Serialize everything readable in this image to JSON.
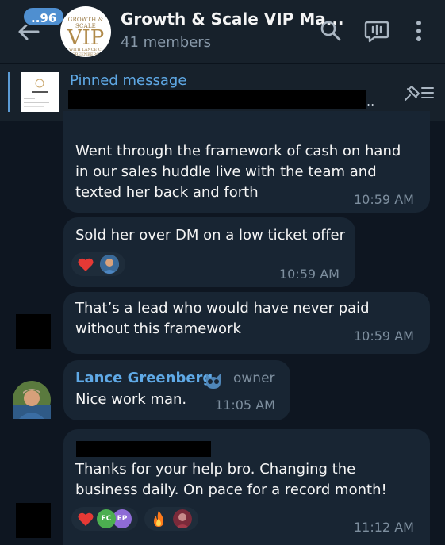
{
  "header": {
    "unread_count": "..96",
    "chat_title": "Growth & Scale VIP Ma...",
    "members": "41 members",
    "avatar_text_top": "GROWTH & SCALE",
    "avatar_text_main": "VIP",
    "avatar_text_bottom": "WITH LANCE C. GREENBERG"
  },
  "pinned": {
    "label": "Pinned message",
    "ellipsis": ".."
  },
  "messages": [
    {
      "text": "Went through the framework of cash on hand\nin our sales huddle live with the team and\ntexted her back and forth",
      "time": "10:59 AM"
    },
    {
      "text": "Sold her over DM on a low ticket offer",
      "time": "10:59 AM"
    },
    {
      "text": "That’s a lead who would have never paid\nwithout this framework",
      "time": "10:59 AM"
    },
    {
      "sender": "Lance Greenberg",
      "role": "owner",
      "text": "Nice work man.",
      "time": "11:05 AM"
    },
    {
      "text": "Thanks for your help bro. Changing the\nbusiness daily. On pace for a record month!",
      "time": "11:12 AM",
      "initials_fc": "FC",
      "initials_ep": "EP"
    }
  ],
  "colors": {
    "accent": "#5fa9e6",
    "bubble": "#182533",
    "background": "#0e1621",
    "header": "#17212b"
  }
}
